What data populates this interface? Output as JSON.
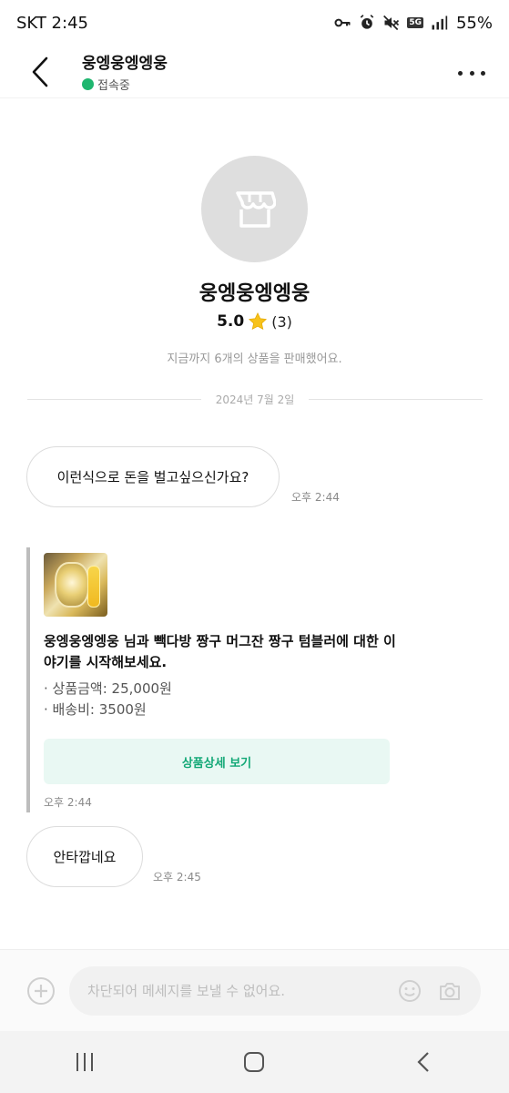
{
  "status_bar": {
    "carrier_time": "SKT 2:45",
    "network_badge": "5G",
    "battery": "55%",
    "icons": [
      "key-icon",
      "alarm-icon",
      "mute-icon",
      "network-5g-icon",
      "signal-icon"
    ]
  },
  "header": {
    "title": "웅엥웅엥엥웅",
    "presence": "접속중",
    "presence_color": "#1fb66f"
  },
  "profile": {
    "name": "웅엥웅엥엥웅",
    "rating": "5.0",
    "review_count": "(3)",
    "sold_note": "지금까지 6개의 상품을 판매했어요."
  },
  "date_divider": "2024년 7월 2일",
  "messages": [
    {
      "text": "이런식으로 돈을 벌고싶으신가요?",
      "time": "오후 2:44"
    },
    {
      "text": "안타깝네요",
      "time": "오후 2:45"
    }
  ],
  "product_card": {
    "title": "웅엥웅엥엥웅 님과 빽다방 짱구 머그잔 짱구 텀블러에 대한 이야기를 시작해보세요.",
    "price": "· 상품금액: 25,000원",
    "shipping": "· 배송비: 3500원",
    "button_label": "상품상세 보기",
    "time": "오후 2:44",
    "accent_color": "#12a876"
  },
  "input": {
    "placeholder": "차단되어 메세지를 보낼 수 없어요."
  },
  "nav": [
    "recent-apps-icon",
    "home-icon",
    "back-icon"
  ]
}
